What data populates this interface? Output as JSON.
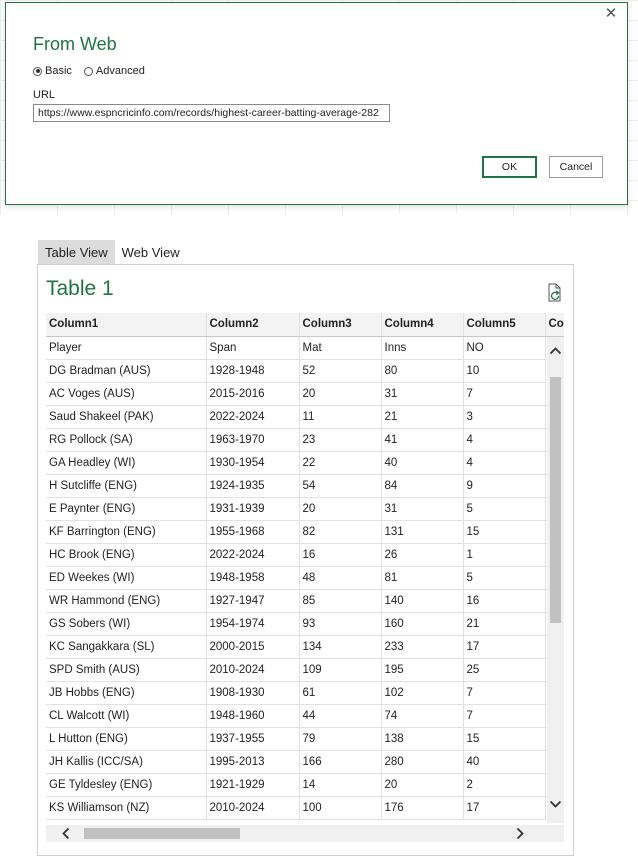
{
  "dialog": {
    "title": "From Web",
    "radio_basic": "Basic",
    "radio_advanced": "Advanced",
    "selected_mode": "Basic",
    "url_label": "URL",
    "url_value": "https://www.espncricinfo.com/records/highest-career-batting-average-282",
    "ok_label": "OK",
    "cancel_label": "Cancel",
    "close_glyph": "✕"
  },
  "preview": {
    "tabs": [
      {
        "label": "Table View",
        "active": true
      },
      {
        "label": "Web View",
        "active": false
      }
    ],
    "table_title": "Table 1",
    "columns": [
      "Column1",
      "Column2",
      "Column3",
      "Column4",
      "Column5",
      "Col"
    ],
    "rows": [
      [
        "Player",
        "Span",
        "Mat",
        "Inns",
        "NO"
      ],
      [
        "DG Bradman (AUS)",
        "1928-1948",
        "52",
        "80",
        "10"
      ],
      [
        "AC Voges (AUS)",
        "2015-2016",
        "20",
        "31",
        "7"
      ],
      [
        "Saud Shakeel (PAK)",
        "2022-2024",
        "11",
        "21",
        "3"
      ],
      [
        "RG Pollock (SA)",
        "1963-1970",
        "23",
        "41",
        "4"
      ],
      [
        "GA Headley (WI)",
        "1930-1954",
        "22",
        "40",
        "4"
      ],
      [
        "H Sutcliffe (ENG)",
        "1924-1935",
        "54",
        "84",
        "9"
      ],
      [
        "E Paynter (ENG)",
        "1931-1939",
        "20",
        "31",
        "5"
      ],
      [
        "KF Barrington (ENG)",
        "1955-1968",
        "82",
        "131",
        "15"
      ],
      [
        "HC Brook (ENG)",
        "2022-2024",
        "16",
        "26",
        "1"
      ],
      [
        "ED Weekes (WI)",
        "1948-1958",
        "48",
        "81",
        "5"
      ],
      [
        "WR Hammond (ENG)",
        "1927-1947",
        "85",
        "140",
        "16"
      ],
      [
        "GS Sobers (WI)",
        "1954-1974",
        "93",
        "160",
        "21"
      ],
      [
        "KC Sangakkara (SL)",
        "2000-2015",
        "134",
        "233",
        "17"
      ],
      [
        "SPD Smith (AUS)",
        "2010-2024",
        "109",
        "195",
        "25"
      ],
      [
        "JB Hobbs (ENG)",
        "1908-1930",
        "61",
        "102",
        "7"
      ],
      [
        "CL Walcott (WI)",
        "1948-1960",
        "44",
        "74",
        "7"
      ],
      [
        "L Hutton (ENG)",
        "1937-1955",
        "79",
        "138",
        "15"
      ],
      [
        "JH Kallis (ICC/SA)",
        "1995-2013",
        "166",
        "280",
        "40"
      ],
      [
        "GE Tyldesley (ENG)",
        "1921-1929",
        "14",
        "20",
        "2"
      ],
      [
        "KS Williamson (NZ)",
        "2010-2024",
        "100",
        "176",
        "17"
      ]
    ]
  },
  "colors": {
    "accent_green": "#217346",
    "header_bg": "#f3f3f3",
    "tab_active_bg": "#dcdcdc",
    "scroll_thumb": "#c1c1c1"
  },
  "icons": {
    "close": "close-icon",
    "refresh": "refresh-icon",
    "scroll_up": "chevron-up-icon",
    "scroll_down": "chevron-down-icon",
    "scroll_left": "chevron-left-icon",
    "scroll_right": "chevron-right-icon"
  }
}
